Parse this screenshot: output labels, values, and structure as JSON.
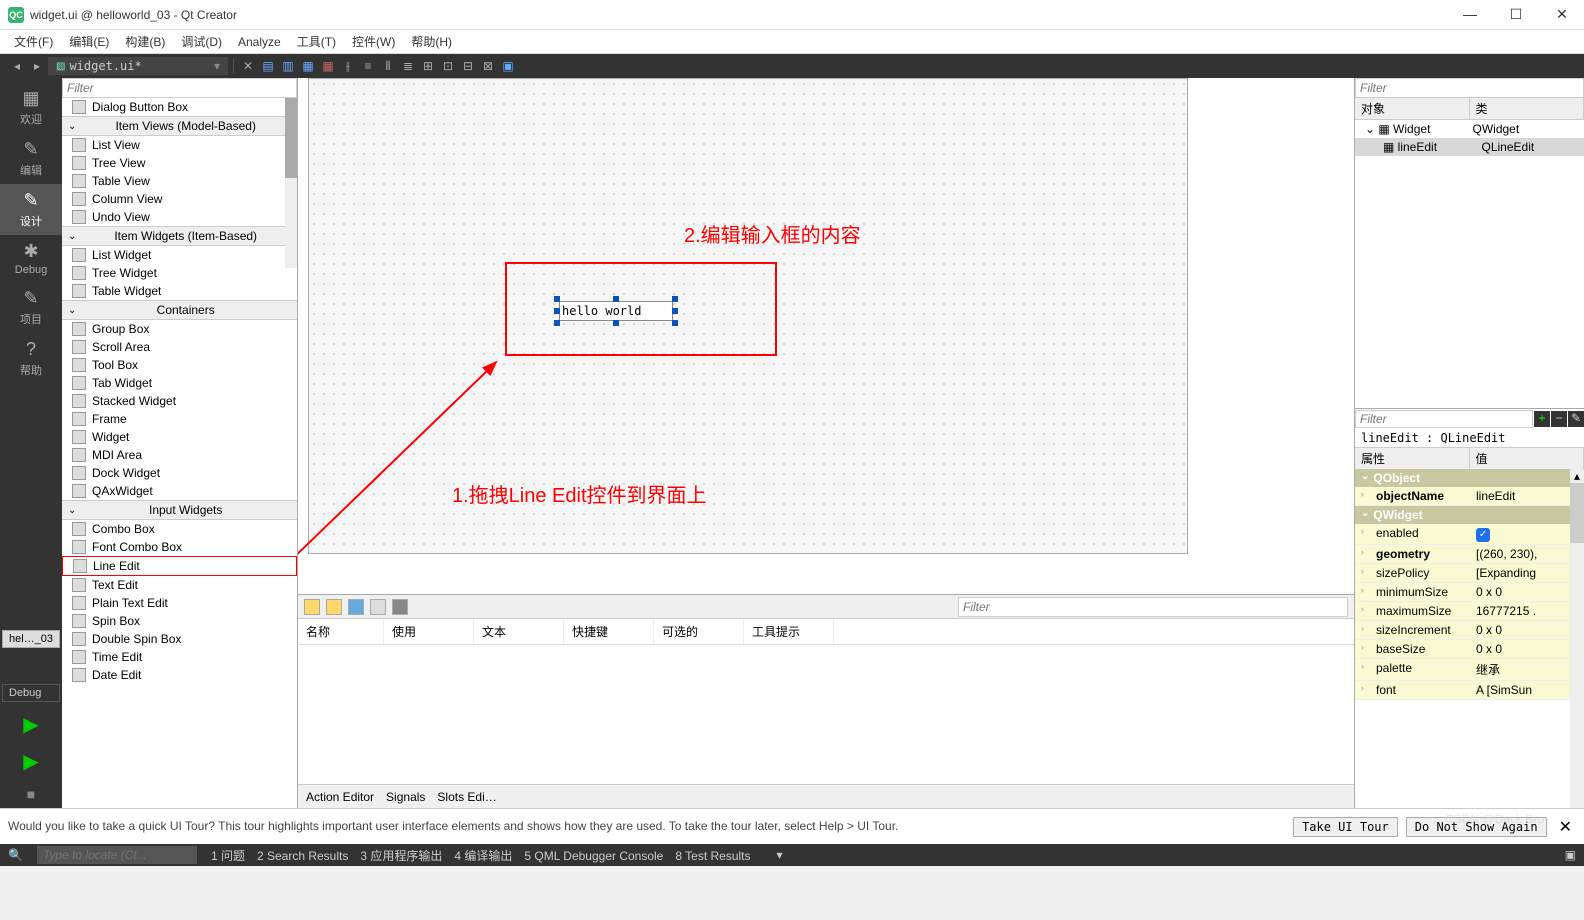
{
  "window": {
    "title": "widget.ui @ helloworld_03 - Qt Creator",
    "icon_label": "QC"
  },
  "menu": [
    "文件(F)",
    "编辑(E)",
    "构建(B)",
    "调试(D)",
    "Analyze",
    "工具(T)",
    "控件(W)",
    "帮助(H)"
  ],
  "open_tab": "widget.ui*",
  "modes": [
    {
      "icon": "▦",
      "label": "欢迎"
    },
    {
      "icon": "✎",
      "label": "编辑"
    },
    {
      "icon": "✎",
      "label": "设计",
      "active": true
    },
    {
      "icon": "✱",
      "label": "Debug"
    },
    {
      "icon": "✎",
      "label": "项目"
    },
    {
      "icon": "?",
      "label": "帮助"
    }
  ],
  "sidetab": "hel…_03",
  "sidetab2": "Debug",
  "widgetbox": {
    "filter_placeholder": "Filter",
    "items": [
      {
        "type": "item",
        "label": "Dialog Button Box"
      },
      {
        "type": "cat",
        "label": "Item Views (Model-Based)"
      },
      {
        "type": "item",
        "label": "List View"
      },
      {
        "type": "item",
        "label": "Tree View"
      },
      {
        "type": "item",
        "label": "Table View"
      },
      {
        "type": "item",
        "label": "Column View"
      },
      {
        "type": "item",
        "label": "Undo View"
      },
      {
        "type": "cat",
        "label": "Item Widgets (Item-Based)"
      },
      {
        "type": "item",
        "label": "List Widget"
      },
      {
        "type": "item",
        "label": "Tree Widget"
      },
      {
        "type": "item",
        "label": "Table Widget"
      },
      {
        "type": "cat",
        "label": "Containers"
      },
      {
        "type": "item",
        "label": "Group Box"
      },
      {
        "type": "item",
        "label": "Scroll Area"
      },
      {
        "type": "item",
        "label": "Tool Box"
      },
      {
        "type": "item",
        "label": "Tab Widget"
      },
      {
        "type": "item",
        "label": "Stacked Widget"
      },
      {
        "type": "item",
        "label": "Frame"
      },
      {
        "type": "item",
        "label": "Widget"
      },
      {
        "type": "item",
        "label": "MDI Area"
      },
      {
        "type": "item",
        "label": "Dock Widget"
      },
      {
        "type": "item",
        "label": "QAxWidget"
      },
      {
        "type": "cat",
        "label": "Input Widgets"
      },
      {
        "type": "item",
        "label": "Combo Box"
      },
      {
        "type": "item",
        "label": "Font Combo Box"
      },
      {
        "type": "item",
        "label": "Line Edit",
        "highlight": true
      },
      {
        "type": "item",
        "label": "Text Edit"
      },
      {
        "type": "item",
        "label": "Plain Text Edit"
      },
      {
        "type": "item",
        "label": "Spin Box"
      },
      {
        "type": "item",
        "label": "Double Spin Box"
      },
      {
        "type": "item",
        "label": "Time Edit"
      },
      {
        "type": "item",
        "label": "Date Edit"
      }
    ]
  },
  "canvas": {
    "lineedit_value": "hello world",
    "annotation1": "2.编辑输入框的内容",
    "annotation2": "1.拖拽Line Edit控件到界面上"
  },
  "actions": {
    "filter_placeholder": "Filter",
    "headers": [
      "名称",
      "使用",
      "文本",
      "快捷键",
      "可选的",
      "工具提示"
    ],
    "tabs": [
      "Action Editor",
      "Signals",
      "Slots Edi…"
    ]
  },
  "objtree": {
    "filter_placeholder": "Filter",
    "hdr_obj": "对象",
    "hdr_cls": "类",
    "rows": [
      {
        "obj": "Widget",
        "cls": "QWidget",
        "indent": 0
      },
      {
        "obj": "lineEdit",
        "cls": "QLineEdit",
        "indent": 1,
        "sel": true
      }
    ]
  },
  "props": {
    "filter_placeholder": "Filter",
    "title": "lineEdit : QLineEdit",
    "hdr_prop": "属性",
    "hdr_val": "值",
    "groups": [
      {
        "cat": "QObject",
        "rows": [
          {
            "name": "objectName",
            "val": "lineEdit",
            "bold": true
          }
        ]
      },
      {
        "cat": "QWidget",
        "rows": [
          {
            "name": "enabled",
            "val": "checkbox"
          },
          {
            "name": "geometry",
            "val": "[(260, 230),",
            "bold": true
          },
          {
            "name": "sizePolicy",
            "val": "[Expanding"
          },
          {
            "name": "minimumSize",
            "val": "0 x 0"
          },
          {
            "name": "maximumSize",
            "val": "16777215 ."
          },
          {
            "name": "sizeIncrement",
            "val": "0 x 0"
          },
          {
            "name": "baseSize",
            "val": "0 x 0"
          },
          {
            "name": "palette",
            "val": "继承"
          },
          {
            "name": "font",
            "val": "A [SimSun"
          }
        ]
      }
    ]
  },
  "tour": {
    "msg": "Would you like to take a quick UI Tour? This tour highlights important user interface elements and shows how they are used. To take the tour later, select Help > UI Tour.",
    "btn1": "Take UI Tour",
    "btn2": "Do Not Show Again"
  },
  "status": {
    "search_placeholder": "Type to locate (Ct...",
    "items": [
      "1 问题",
      "2 Search Results",
      "3 应用程序输出",
      "4 编译输出",
      "5 QML Debugger Console",
      "8 Test Results"
    ]
  },
  "watermark": "CSDN @Dack Bro"
}
